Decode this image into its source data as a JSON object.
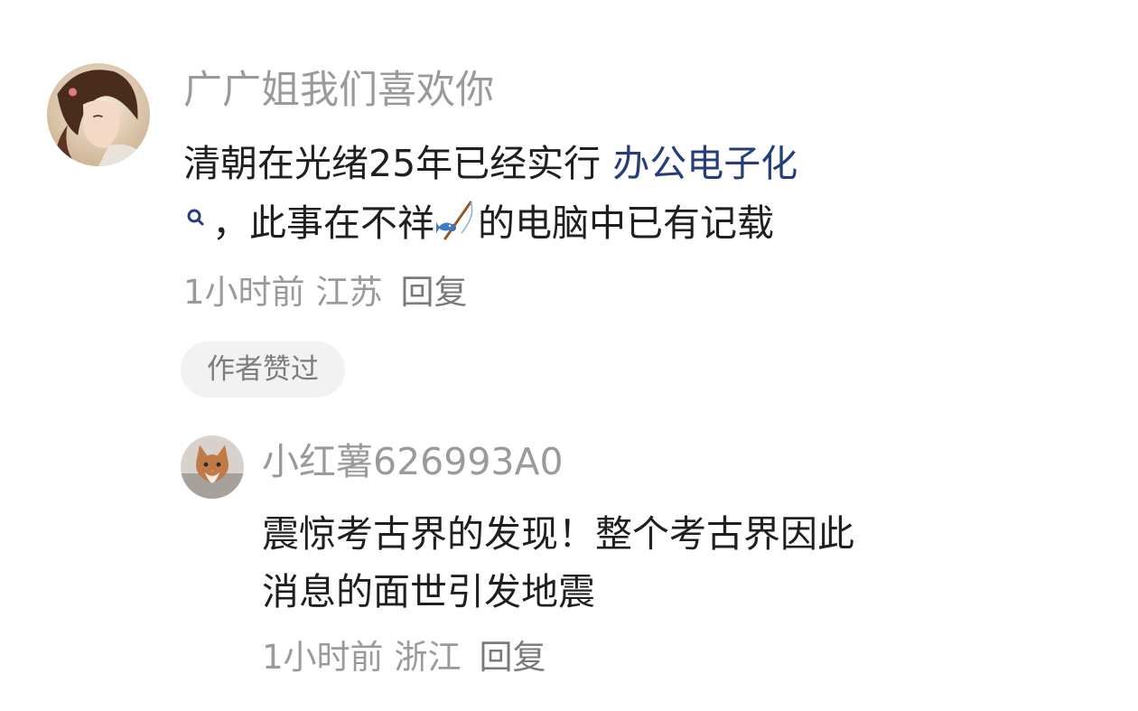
{
  "comment": {
    "avatar_icon": "user-avatar-illustrated-portrait",
    "username": "广广姐我们喜欢你",
    "text_before_link": "清朝在光绪25年已经实行 ",
    "link_text": "办公电子化",
    "search_icon": "search-icon",
    "text_mid": "，此事在不祥",
    "emoji": "fishing-pole-emoji",
    "text_after": "的电脑中已有记载",
    "time": "1小时前",
    "location": "江苏",
    "reply_label": "回复",
    "badge": "作者赞过"
  },
  "reply": {
    "avatar_icon": "user-avatar-cat",
    "username": "小红薯626993A0",
    "line1": "震惊考古界的发现！整个考古界因此",
    "line2": "消息的面世引发地震",
    "time": "1小时前",
    "location": "浙江",
    "reply_label": "回复"
  },
  "colors": {
    "link": "#253d79",
    "meta": "#9a9a9a",
    "text": "#1f1f1f",
    "badge_bg": "#f2f2f2"
  }
}
